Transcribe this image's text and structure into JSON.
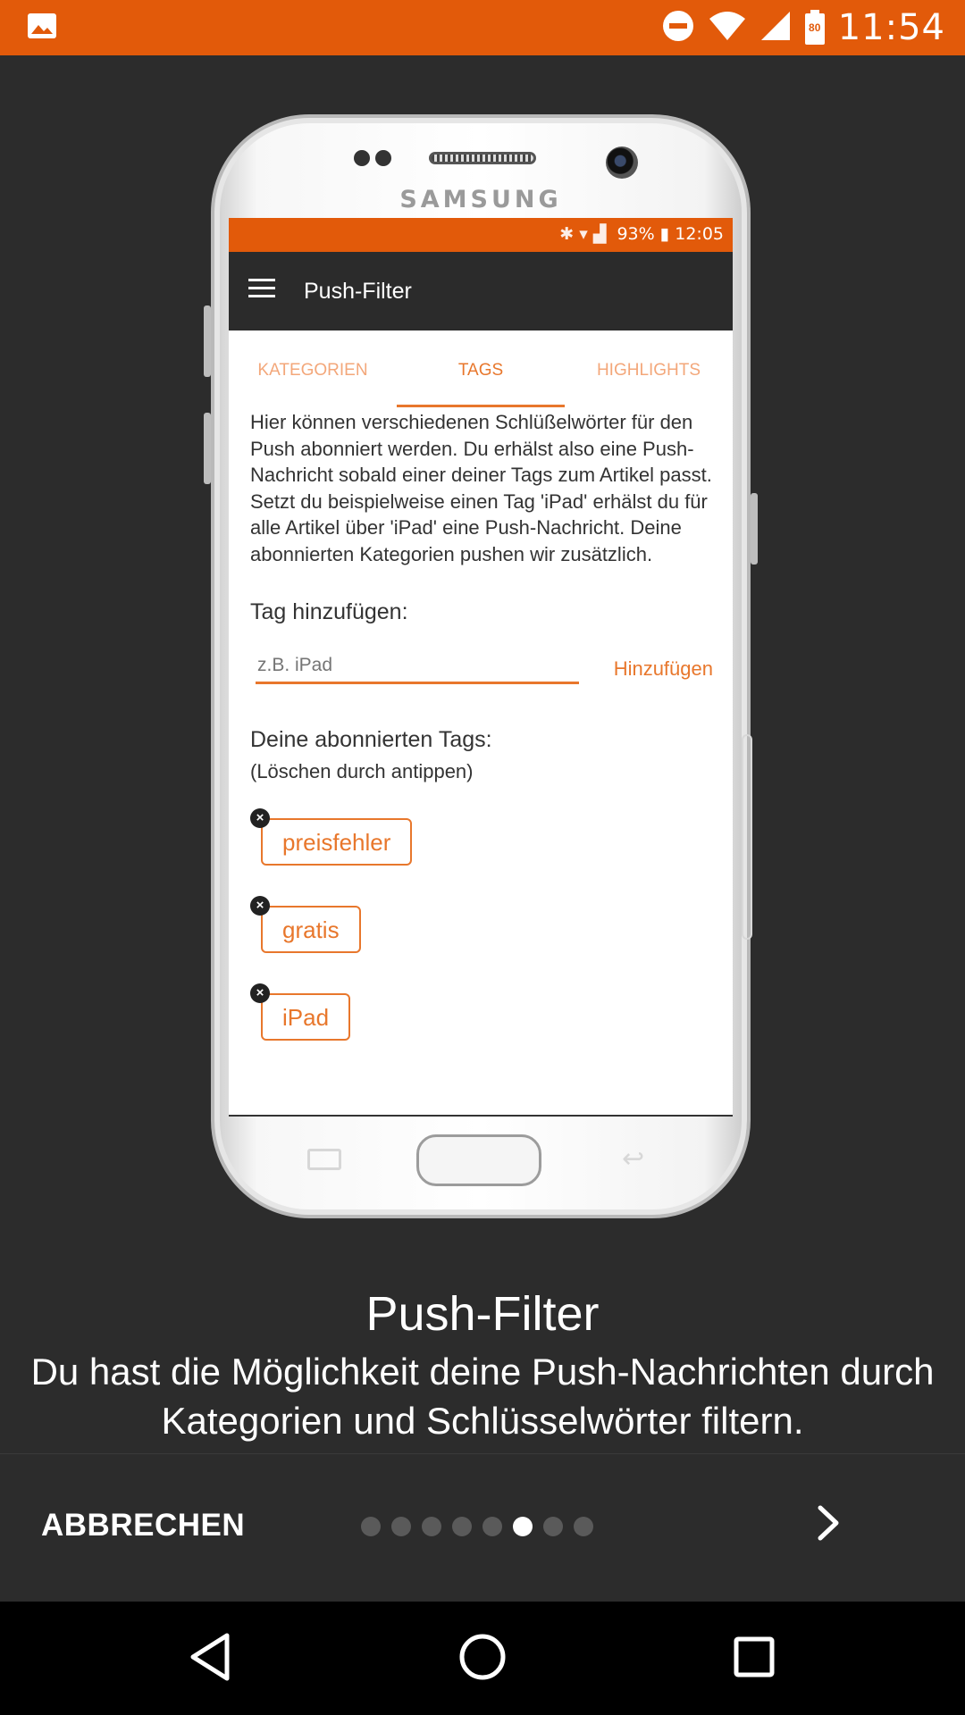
{
  "status_bar": {
    "time": "11:54",
    "battery_text": "80",
    "icons": [
      "image-icon",
      "do-not-disturb-icon",
      "wifi-icon",
      "signal-icon",
      "battery-icon"
    ]
  },
  "phone_mockup": {
    "brand": "SAMSUNG",
    "inner_status": {
      "battery": "93%",
      "time": "12:05"
    },
    "app_title": "Push-Filter",
    "tabs": [
      {
        "label": "KATEGORIEN",
        "active": false
      },
      {
        "label": "TAGS",
        "active": true
      },
      {
        "label": "HIGHLIGHTS",
        "active": false
      }
    ],
    "description": "Hier können verschiedenen Schlüßelwörter für den Push abonniert werden. Du erhälst also eine Push-Nachricht sobald einer deiner Tags zum Artikel passt. Setzt du beispielweise einen Tag 'iPad' erhälst du für alle Artikel über 'iPad' eine Push-Nachricht. Deine abonnierten Kategorien pushen wir zusätzlich.",
    "add_tag_label": "Tag hinzufügen:",
    "input_placeholder": "z.B. iPad",
    "add_button": "Hinzufügen",
    "subscribed_label": "Deine abonnierten Tags:",
    "subscribed_hint": "(Löschen durch antippen)",
    "tags": [
      "preisfehler",
      "gratis",
      "iPad"
    ],
    "accent_color": "#e8772c"
  },
  "caption": {
    "title": "Push-Filter",
    "text": "Du hast die Möglichkeit deine Push-Nachrichten durch Kategorien und Schlüsselwörter filtern."
  },
  "footer": {
    "skip_label": "ABBRECHEN",
    "pages_total": 8,
    "page_active": 6,
    "next_icon": "chevron-right-icon"
  },
  "colors": {
    "status_bar": "#e25a0a",
    "background": "#2c2c2c",
    "nav_bar": "#000000"
  }
}
